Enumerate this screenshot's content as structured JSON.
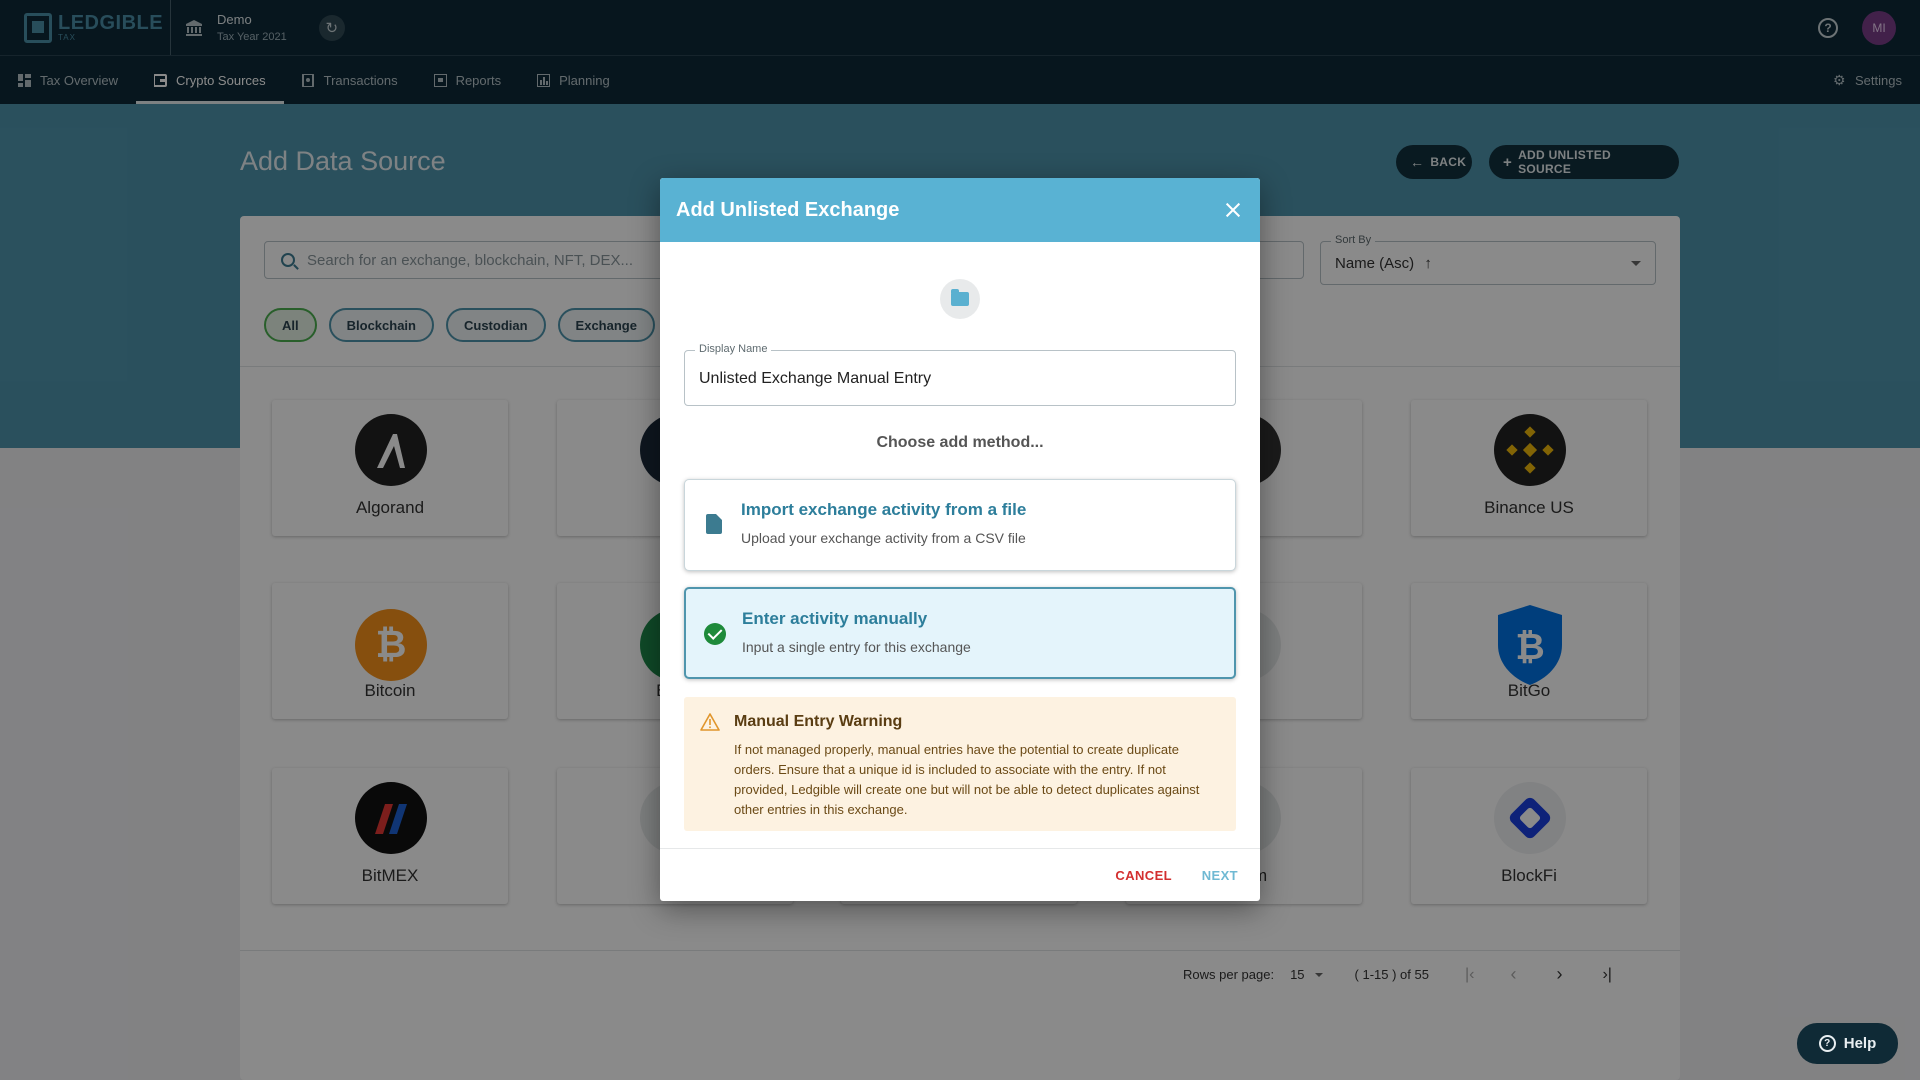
{
  "app": {
    "logo_main": "LEDGIBLE",
    "logo_sub": "TAX"
  },
  "account": {
    "name": "Demo",
    "year": "Tax Year 2021"
  },
  "user": {
    "initials": "MI"
  },
  "nav": {
    "items": [
      "Tax Overview",
      "Crypto Sources",
      "Transactions",
      "Reports",
      "Planning"
    ],
    "settings": "Settings"
  },
  "page": {
    "title": "Add Data Source",
    "back_label": "BACK",
    "add_unlisted_label": "ADD UNLISTED SOURCE"
  },
  "search": {
    "placeholder": "Search for an exchange, blockchain, NFT, DEX..."
  },
  "sort": {
    "label": "Sort By",
    "value": "Name (Asc)"
  },
  "filters": [
    "All",
    "Blockchain",
    "Custodian",
    "Exchange"
  ],
  "sources": {
    "row1": [
      "Algorand",
      "Anc",
      "ce",
      "Binance US"
    ],
    "row2": [
      "Bitcoin",
      "Bitco",
      "ex",
      "BitGo"
    ],
    "row3": [
      "BitMEX",
      "Bit",
      "n.com",
      "BlockFi"
    ]
  },
  "pagination": {
    "rows_label": "Rows per page:",
    "rows_value": "15",
    "range": "( 1-15 ) of 55"
  },
  "dialog": {
    "title": "Add Unlisted Exchange",
    "display_name_label": "Display Name",
    "display_name_value": "Unlisted Exchange Manual Entry",
    "choose_text": "Choose add method...",
    "options": [
      {
        "title": "Import exchange activity from a file",
        "desc": "Upload your exchange activity from a CSV file"
      },
      {
        "title": "Enter activity manually",
        "desc": "Input a single entry for this exchange"
      }
    ],
    "warning_title": "Manual Entry Warning",
    "warning_body": "If not managed properly, manual entries have the potential to create duplicate orders. Ensure that a unique id is included to associate with the entry. If not provided, Ledgible will create one but will not be able to detect duplicates against other entries in this exchange.",
    "cancel_label": "CANCEL",
    "next_label": "NEXT"
  },
  "help_label": "Help",
  "colors": {
    "brand_dark": "#0d2a38",
    "accent": "#59b2d3",
    "selected": "#4f95ad",
    "success": "#1e8a3a",
    "danger": "#d32f2f"
  }
}
